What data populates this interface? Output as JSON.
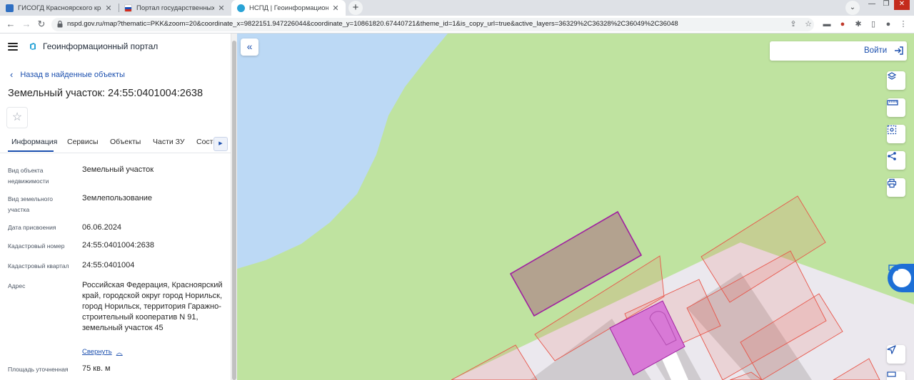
{
  "browser": {
    "tabs": [
      {
        "title": "ГИСОГД Красноярского края",
        "active": false
      },
      {
        "title": "Портал государственных услуг Р",
        "active": false
      },
      {
        "title": "НСПД | Геоинформационный по",
        "active": true
      }
    ],
    "url": "nspd.gov.ru/map?thematic=PKK&zoom=20&coordinate_x=9822151.947226044&coordinate_y=10861820.67440721&theme_id=1&is_copy_url=true&active_layers=36329%2C36328%2C36049%2C36048"
  },
  "sidebar": {
    "portal_title": "Геоинформационный портал",
    "back_link": "Назад в найденные объекты",
    "object_title": "Земельный участок: 24:55:0401004:2638",
    "tabs": [
      "Информация",
      "Сервисы",
      "Объекты",
      "Части ЗУ",
      "Состав"
    ],
    "active_tab": "Информация",
    "fields": [
      {
        "label": "Вид объекта недвижимости",
        "value": "Земельный участок"
      },
      {
        "label": "Вид земельного участка",
        "value": "Землепользование"
      },
      {
        "label": "Дата присвоения",
        "value": "06.06.2024"
      },
      {
        "label": "Кадастровый номер",
        "value": "24:55:0401004:2638"
      },
      {
        "label": "Кадастровый квартал",
        "value": "24:55:0401004"
      },
      {
        "label": "Адрес",
        "value": "Российская Федерация, Красноярский край, городской округ город Норильск, город Норильск, территория Гаражно-строительный кооператив N 91, земельный участок 45"
      },
      {
        "label": "Площадь уточненная",
        "value": "75 кв. м"
      }
    ],
    "collapse_link": "Свернуть"
  },
  "map": {
    "login_label": "Войти",
    "tools": [
      "layers-icon",
      "ruler-icon",
      "area-select-icon",
      "share-icon",
      "print-icon",
      "locate-icon"
    ],
    "colors": {
      "land": "#bfe3a0",
      "water": "#bcd9f5",
      "selected_parcel_stroke": "#a020a0",
      "highlighted_fill": "#d879d6",
      "parcel_stroke": "#e8564a"
    }
  }
}
